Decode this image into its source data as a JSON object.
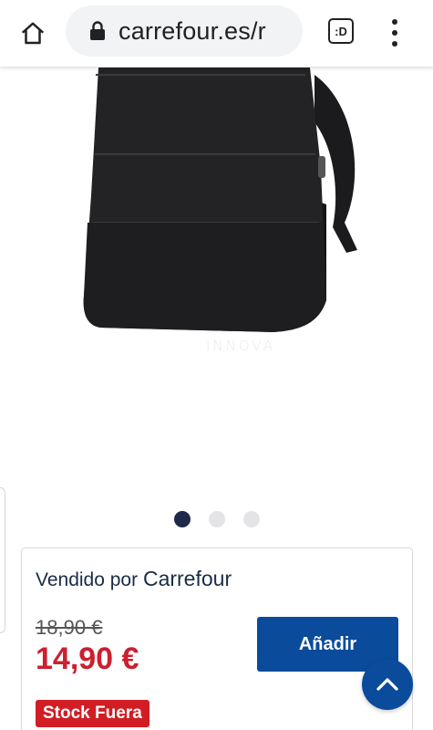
{
  "browser": {
    "url": "carrefour.es/r",
    "tabs_count": ":D"
  },
  "product": {
    "brand_mark": "INNOVA",
    "image_count": 3,
    "active_image_index": 0
  },
  "seller_card": {
    "sold_by_prefix": "Vendido por",
    "seller_name": "Carrefour",
    "old_price": "18,90 €",
    "new_price": "14,90 €",
    "add_label": "Añadir",
    "stock_label": "Stock Fuera"
  },
  "colors": {
    "brand_blue": "#0a4b9b",
    "price_red": "#cc1f2f",
    "badge_red": "#d01e24",
    "dot_active": "#1f2a4a"
  },
  "icons": {
    "home": "home-icon",
    "lock": "lock-icon",
    "menu": "more-vert-icon",
    "scroll_top": "chevron-up-icon"
  }
}
